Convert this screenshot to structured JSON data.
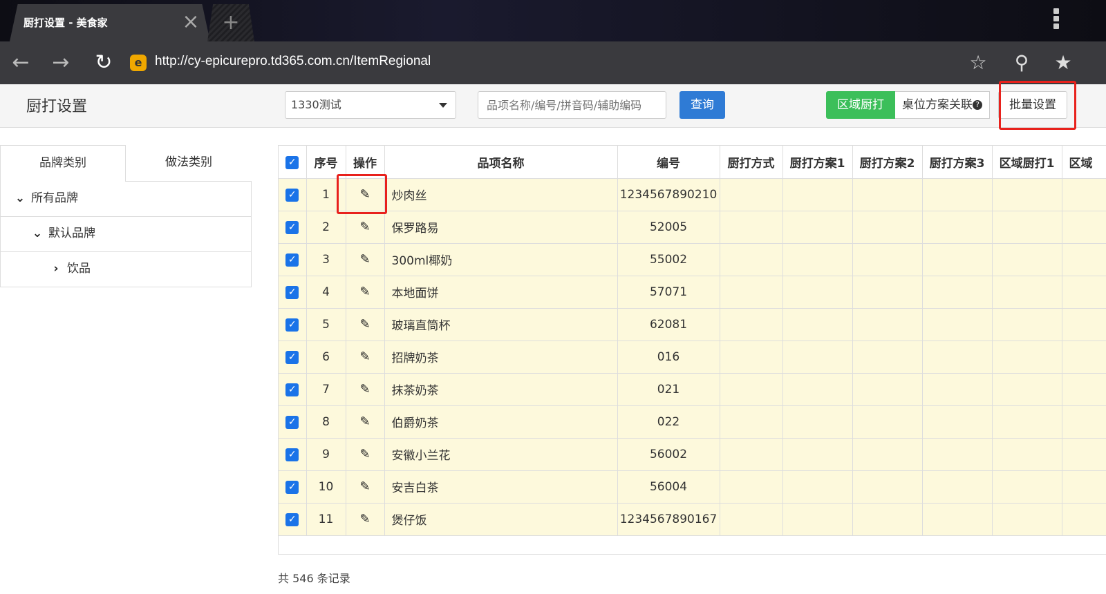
{
  "browser": {
    "tab_title": "厨打设置 - 美食家",
    "tab_close": "×",
    "new_tab": "+",
    "url": "http://cy-epicurepro.td365.com.cn/ItemRegional",
    "back": "←",
    "forward": "→",
    "reload": "↻",
    "star": "☆",
    "search": "⚲",
    "bookmark": "★"
  },
  "header": {
    "title": "厨打设置",
    "store_select": "1330测试",
    "search_placeholder": "品项名称/编号/拼音码/辅助编码",
    "query_label": "查询",
    "region_print_label": "区域厨打",
    "desk_plan_label": "桌位方案关联",
    "help": "?",
    "batch_label": "批量设置"
  },
  "sidebar": {
    "tabs": [
      "品牌类别",
      "做法类别"
    ],
    "tree": [
      {
        "label": "所有品牌",
        "chev": "⌄"
      },
      {
        "label": "默认品牌",
        "chev": "⌄"
      },
      {
        "label": "饮品",
        "chev": "›"
      }
    ]
  },
  "table": {
    "columns": [
      "序号",
      "操作",
      "品项名称",
      "编号",
      "厨打方式",
      "厨打方案1",
      "厨打方案2",
      "厨打方案3",
      "区域厨打1",
      "区域"
    ],
    "rows": [
      {
        "no": "1",
        "name": "炒肉丝",
        "code": "1234567890210"
      },
      {
        "no": "2",
        "name": "保罗路易",
        "code": "52005"
      },
      {
        "no": "3",
        "name": "300ml椰奶",
        "code": "55002"
      },
      {
        "no": "4",
        "name": "本地面饼",
        "code": "57071"
      },
      {
        "no": "5",
        "name": "玻璃直筒杯",
        "code": "62081"
      },
      {
        "no": "6",
        "name": "招牌奶茶",
        "code": "016"
      },
      {
        "no": "7",
        "name": "抹茶奶茶",
        "code": "021"
      },
      {
        "no": "8",
        "name": "伯爵奶茶",
        "code": "022"
      },
      {
        "no": "9",
        "name": "安徽小兰花",
        "code": "56002"
      },
      {
        "no": "10",
        "name": "安吉白茶",
        "code": "56004"
      },
      {
        "no": "11",
        "name": "煲仔饭",
        "code": "1234567890167"
      }
    ],
    "check": "✓",
    "edit_icon": "✎"
  },
  "footer": {
    "total_text": "共 546 条记录"
  }
}
